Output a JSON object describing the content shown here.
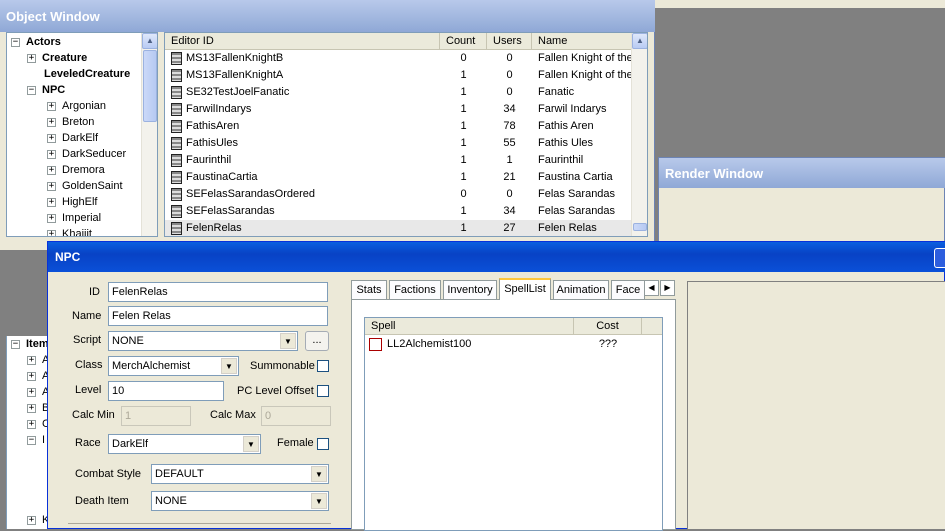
{
  "object_window": {
    "title": "Object Window",
    "tree": [
      {
        "label": "Actors",
        "exp": "−",
        "bold": true
      },
      {
        "label": "Creature",
        "exp": "+",
        "bold": true
      },
      {
        "label": "LeveledCreature",
        "exp": "",
        "bold": true
      },
      {
        "label": "NPC",
        "exp": "−",
        "bold": true
      },
      {
        "label": "Argonian",
        "exp": "+",
        "bold": false
      },
      {
        "label": "Breton",
        "exp": "+",
        "bold": false
      },
      {
        "label": "DarkElf",
        "exp": "+",
        "bold": false
      },
      {
        "label": "DarkSeducer",
        "exp": "+",
        "bold": false
      },
      {
        "label": "Dremora",
        "exp": "+",
        "bold": false
      },
      {
        "label": "GoldenSaint",
        "exp": "+",
        "bold": false
      },
      {
        "label": "HighElf",
        "exp": "+",
        "bold": false
      },
      {
        "label": "Imperial",
        "exp": "+",
        "bold": false
      },
      {
        "label": "Khajiit",
        "exp": "+",
        "bold": false
      }
    ],
    "tree_lower": [
      {
        "label": "Item",
        "exp": "−",
        "bold": true
      },
      {
        "label": "A",
        "exp": "+",
        "bold": false
      },
      {
        "label": "A",
        "exp": "+",
        "bold": false
      },
      {
        "label": "A",
        "exp": "+",
        "bold": false
      },
      {
        "label": "B",
        "exp": "+",
        "bold": false
      },
      {
        "label": "C",
        "exp": "+",
        "bold": false
      },
      {
        "label": "I",
        "exp": "−",
        "bold": false
      },
      {
        "label": "K",
        "exp": "+",
        "bold": false
      }
    ],
    "columns": [
      "Editor ID",
      "Count",
      "Users",
      "Name"
    ],
    "rows": [
      {
        "id": "MS13FallenKnightB",
        "count": "0",
        "users": "0",
        "name": "Fallen Knight of the"
      },
      {
        "id": "MS13FallenKnightA",
        "count": "1",
        "users": "0",
        "name": "Fallen Knight of the"
      },
      {
        "id": "SE32TestJoelFanatic",
        "count": "1",
        "users": "0",
        "name": "Fanatic"
      },
      {
        "id": "FarwilIndarys",
        "count": "1",
        "users": "34",
        "name": "Farwil Indarys"
      },
      {
        "id": "FathisAren",
        "count": "1",
        "users": "78",
        "name": "Fathis Aren"
      },
      {
        "id": "FathisUles",
        "count": "1",
        "users": "55",
        "name": "Fathis Ules"
      },
      {
        "id": "Faurinthil",
        "count": "1",
        "users": "1",
        "name": "Faurinthil"
      },
      {
        "id": "FaustinaCartia",
        "count": "1",
        "users": "21",
        "name": "Faustina Cartia"
      },
      {
        "id": "SEFelasSarandasOrdered",
        "count": "0",
        "users": "0",
        "name": "Felas Sarandas"
      },
      {
        "id": "SEFelasSarandas",
        "count": "1",
        "users": "34",
        "name": "Felas Sarandas"
      },
      {
        "id": "FelenRelas",
        "count": "1",
        "users": "27",
        "name": "Felen Relas"
      }
    ]
  },
  "render_window": {
    "title": "Render Window"
  },
  "npc": {
    "title": "NPC",
    "id_label": "ID",
    "id_value": "FelenRelas",
    "name_label": "Name",
    "name_value": "Felen Relas",
    "script_label": "Script",
    "script_value": "NONE",
    "script_btn": "...",
    "class_label": "Class",
    "class_value": "MerchAlchemist",
    "summonable_label": "Summonable",
    "level_label": "Level",
    "level_value": "10",
    "pclevel_label": "PC Level Offset",
    "calcmin_label": "Calc Min",
    "calcmin_value": "1",
    "calcmax_label": "Calc Max",
    "calcmax_value": "0",
    "race_label": "Race",
    "race_value": "DarkElf",
    "female_label": "Female",
    "combat_label": "Combat Style",
    "combat_value": "DEFAULT",
    "death_label": "Death Item",
    "death_value": "NONE",
    "tabs": [
      "Stats",
      "Factions",
      "Inventory",
      "SpellList",
      "Animation",
      "Face"
    ],
    "active_tab": "SpellList",
    "spell_columns": [
      "Spell",
      "Cost"
    ],
    "spells": [
      {
        "name": "LL2Alchemist100",
        "cost": "???"
      }
    ]
  }
}
